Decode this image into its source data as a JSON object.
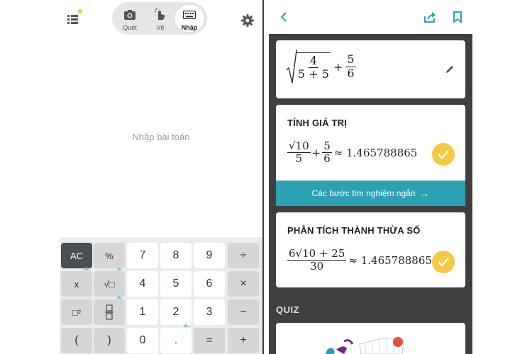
{
  "left": {
    "modes": [
      {
        "label": "Quét",
        "icon": "camera-icon"
      },
      {
        "label": "Vẽ",
        "icon": "hand-draw-icon"
      },
      {
        "label": "Nhập",
        "icon": "keyboard-icon"
      }
    ],
    "active_mode": "Nhập",
    "input_placeholder": "Nhập bài toán",
    "keypad": {
      "ac": "AC",
      "percent": "%",
      "x": "x",
      "sqrt": "√□",
      "pow": "□²",
      "frac": "□/□",
      "lparen": "(",
      "rparen": ")",
      "d7": "7",
      "d8": "8",
      "d9": "9",
      "d4": "4",
      "d5": "5",
      "d6": "6",
      "d1": "1",
      "d2": "2",
      "d3": "3",
      "d0": "0",
      "dot": ".",
      "eq": "=",
      "div": "÷",
      "mul": "×",
      "minus": "−",
      "plus": "+"
    }
  },
  "right": {
    "expression": {
      "sqrt_num": "4",
      "sqrt_den": "5 + 5",
      "plus": "+",
      "frac_num": "5",
      "frac_den": "6"
    },
    "evaluate": {
      "title": "TÍNH GIÁ TRỊ",
      "num1": "√10",
      "den1": "5",
      "plus": "+",
      "num2": "5",
      "den2": "6",
      "approx": "≈ 1.465788865",
      "steps_button": "Các bước tìm nghiệm ngắn",
      "steps_arrow": "→"
    },
    "factor": {
      "title": "PHÂN TÍCH THÀNH THỪA SỐ",
      "num": "6√10 + 25",
      "den": "30",
      "approx": "≈ 1.465788865"
    },
    "quiz_label": "QUIZ"
  },
  "colors": {
    "accent_teal": "#2da1b4",
    "check_yellow": "#f6c844",
    "dark_bg": "#3f3f3f",
    "ac_key": "#4a4f55"
  }
}
